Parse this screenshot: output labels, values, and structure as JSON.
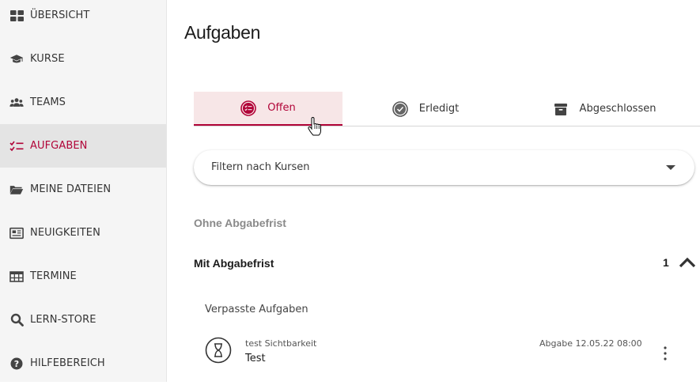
{
  "sidebar": {
    "items": [
      {
        "label": "ÜBERSICHT",
        "icon": "grid-icon"
      },
      {
        "label": "KURSE",
        "icon": "graduation-cap-icon"
      },
      {
        "label": "TEAMS",
        "icon": "team-icon"
      },
      {
        "label": "AUFGABEN",
        "icon": "task-list-icon",
        "active": true
      },
      {
        "label": "MEINE DATEIEN",
        "icon": "folder-icon"
      },
      {
        "label": "NEUIGKEITEN",
        "icon": "newspaper-icon"
      },
      {
        "label": "TERMINE",
        "icon": "calendar-table-icon"
      },
      {
        "label": "LERN-STORE",
        "icon": "search-icon"
      },
      {
        "label": "HILFEBEREICH",
        "icon": "help-icon"
      }
    ]
  },
  "main": {
    "title": "Aufgaben",
    "tabs": [
      {
        "label": "Offen",
        "icon": "open-tasks-icon",
        "active": true
      },
      {
        "label": "Erledigt",
        "icon": "check-circle-icon"
      },
      {
        "label": "Abgeschlossen",
        "icon": "archive-icon"
      }
    ],
    "filter": {
      "placeholder": "Filtern nach Kursen"
    },
    "sections": {
      "without_deadline": "Ohne Abgabefrist",
      "with_deadline": "Mit Abgabefrist",
      "with_deadline_count": "1"
    },
    "missed_label": "Verpasste Aufgaben",
    "task": {
      "course": "test Sichtbarkeit",
      "title": "Test",
      "due": "Abgabe 12.05.22 08:00"
    }
  },
  "colors": {
    "accent": "#b10438",
    "active_tab_bg": "#f7e6e7",
    "sidebar_bg": "#f5f5f5",
    "sidebar_active_bg": "#e4e4e4"
  }
}
